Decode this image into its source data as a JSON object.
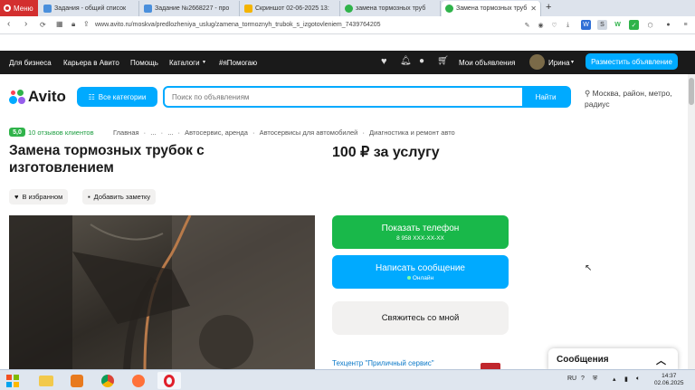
{
  "browser": {
    "menu_label": "Меню",
    "tabs": [
      {
        "label": "Задания - общий список",
        "color": "#4a8fdc"
      },
      {
        "label": "Задание №2668227 - про",
        "color": "#4a8fdc"
      },
      {
        "label": "Скриншот 02-06-2025 13:",
        "color": "#f4b400"
      },
      {
        "label": "замена тормозных труб",
        "color": "#2fb34a"
      },
      {
        "label": "Замена тормозных труб",
        "color": "#2fb34a"
      }
    ],
    "url": "www.avito.ru/moskva/predlozheniya_uslug/zamena_tormoznyh_trubok_s_izgotovleniem_7439764205"
  },
  "topnav": {
    "links": [
      "Для бизнеса",
      "Карьера в Авито",
      "Помощь",
      "Каталоги",
      "#яПомогаю"
    ],
    "my_ads": "Мои объявления",
    "user_name": "Ирина",
    "post_button": "Разместить объявление"
  },
  "search": {
    "logo": "Avito",
    "categories_button": "Все категории",
    "placeholder": "Поиск по объявлениям",
    "find_button": "Найти",
    "location": "Москва, район, метро, радиус"
  },
  "listing": {
    "rating": "5,0",
    "reviews": "10 отзывов клиентов",
    "breadcrumbs": [
      "Главная",
      "·",
      "...",
      "·",
      "...",
      "·",
      "Автосервис, аренда",
      "·",
      "Автосервисы для автомобилей",
      "·",
      "Диагностика и ремонт авто"
    ],
    "title": "Замена тормозных трубок с изготовлением",
    "price": "100 ₽ за услугу",
    "favorite_label": "В избранном",
    "note_label": "Добавить заметку",
    "show_phone": "Показать телефон",
    "phone_masked": "8 958 XXX-XX-XX",
    "write_message": "Написать сообщение",
    "online": "Онлайн",
    "contact_me": "Свяжитесь со мной",
    "seller": "Техцентр \"Приличный сервис\""
  },
  "messages_widget": {
    "label": "Сообщения"
  },
  "taskbar": {
    "lang": "RU",
    "time": "14:37",
    "date": "02.06.2025"
  },
  "colors": {
    "avito_blue": "#00aaff",
    "avito_green": "#19b84a",
    "dark": "#1a1a1a"
  }
}
